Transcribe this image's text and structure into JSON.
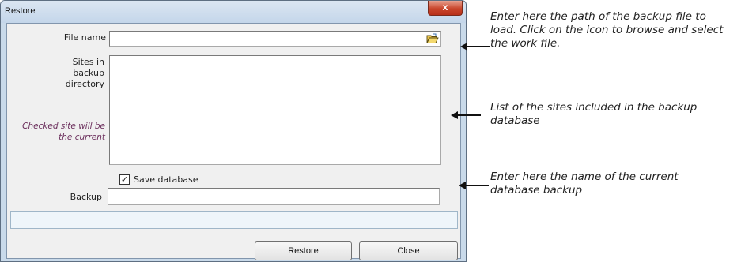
{
  "dialog": {
    "title": "Restore",
    "close_glyph": "x",
    "file_name_label": "File name",
    "file_name_value": "",
    "browse_icon": "folder-open-icon",
    "sites_label": "Sites in backup directory",
    "sites_hint": "Checked site will be the current",
    "sites_items": [],
    "save_database_label": "Save database",
    "save_database_checked": true,
    "backup_label": "Backup",
    "backup_value": "",
    "restore_button": "Restore",
    "close_button": "Close"
  },
  "annotations": {
    "file_name_note": "Enter here the path of the backup file to load. Click on the icon to browse and select the work file.",
    "sites_note": "List of the sites included in the backup database",
    "backup_note": "Enter here the name of the current database backup"
  }
}
